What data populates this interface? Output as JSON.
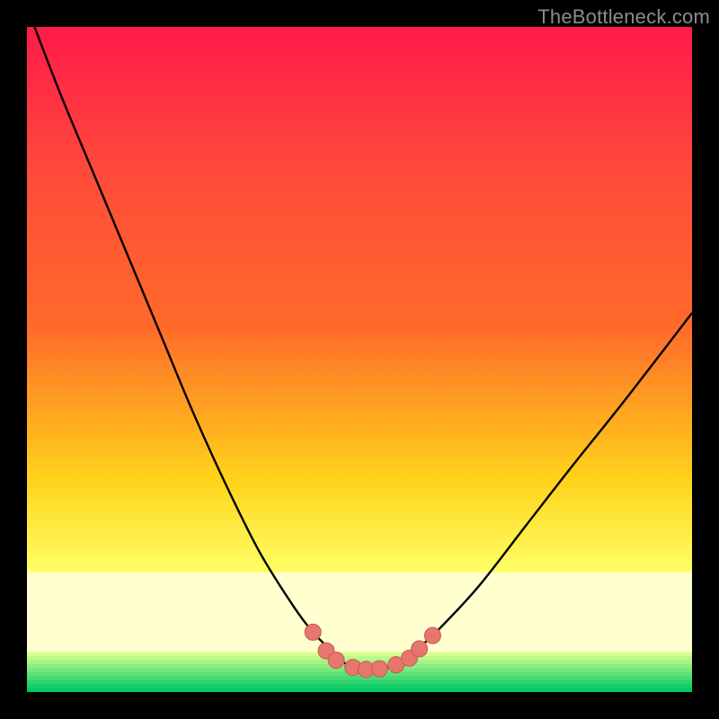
{
  "watermark": {
    "text": "TheBottleneck.com"
  },
  "colors": {
    "top": "#ff1a4b",
    "mid_upper": "#ff6a2a",
    "mid": "#ffd31a",
    "band_pale": "#ffffcf",
    "green_light": "#d4ff8f",
    "green": "#00e676",
    "green_dark": "#00c05a",
    "curve": "#000000",
    "marker_fill": "#e6766e",
    "marker_stroke": "#c75a54"
  },
  "chart_data": {
    "type": "line",
    "title": "",
    "xlabel": "",
    "ylabel": "",
    "xlim": [
      0,
      100
    ],
    "ylim": [
      0,
      100
    ],
    "series": [
      {
        "name": "bottleneck-curve",
        "x": [
          0,
          5,
          10,
          15,
          20,
          25,
          30,
          35,
          40,
          43,
          46,
          48,
          50,
          52,
          54,
          56,
          58,
          62,
          68,
          75,
          82,
          90,
          100
        ],
        "y": [
          103,
          90,
          78,
          66,
          54,
          42,
          31,
          21,
          13,
          9,
          6,
          4.2,
          3.5,
          3.4,
          3.6,
          4.3,
          5.8,
          9.5,
          16,
          25,
          34,
          44,
          57
        ]
      }
    ],
    "markers": [
      {
        "x": 43,
        "y": 9
      },
      {
        "x": 45,
        "y": 6.2
      },
      {
        "x": 46.5,
        "y": 4.8
      },
      {
        "x": 49,
        "y": 3.7
      },
      {
        "x": 51,
        "y": 3.4
      },
      {
        "x": 53,
        "y": 3.5
      },
      {
        "x": 55.5,
        "y": 4.1
      },
      {
        "x": 57.5,
        "y": 5.1
      },
      {
        "x": 59,
        "y": 6.5
      },
      {
        "x": 61,
        "y": 8.5
      }
    ],
    "green_band": {
      "y_start": 0,
      "y_end": 6
    },
    "pale_band": {
      "y_start": 6,
      "y_end": 18
    }
  }
}
